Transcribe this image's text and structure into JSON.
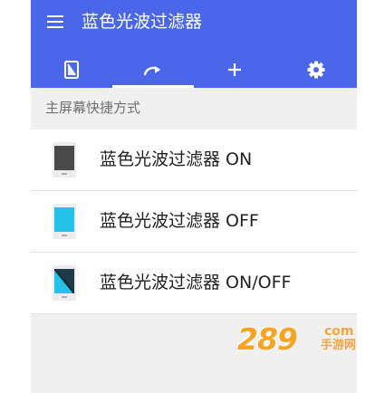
{
  "app_bar": {
    "title": "蓝色光波过滤器",
    "menu_icon": "menu-icon",
    "background": "#4a67ea"
  },
  "tabs": [
    {
      "icon": "filter-toggle-icon",
      "active": false
    },
    {
      "icon": "redo-arrow-icon",
      "active": true
    },
    {
      "icon": "plus-icon",
      "active": false
    },
    {
      "icon": "gear-icon",
      "active": false
    }
  ],
  "section": {
    "header": "主屏幕快捷方式"
  },
  "shortcuts": [
    {
      "label": "蓝色光波过滤器 ON",
      "icon": "phone-dark-screen-icon",
      "screen_color": "#4a4a4a"
    },
    {
      "label": "蓝色光波过滤器 OFF",
      "icon": "phone-cyan-screen-icon",
      "screen_color": "#22c3e6"
    },
    {
      "label": "蓝色光波过滤器 ON/OFF",
      "icon": "phone-split-screen-icon",
      "screen_color": "#1f3b4a"
    }
  ],
  "watermark": {
    "number": "289",
    "suffix": "com",
    "text": "手游网"
  }
}
